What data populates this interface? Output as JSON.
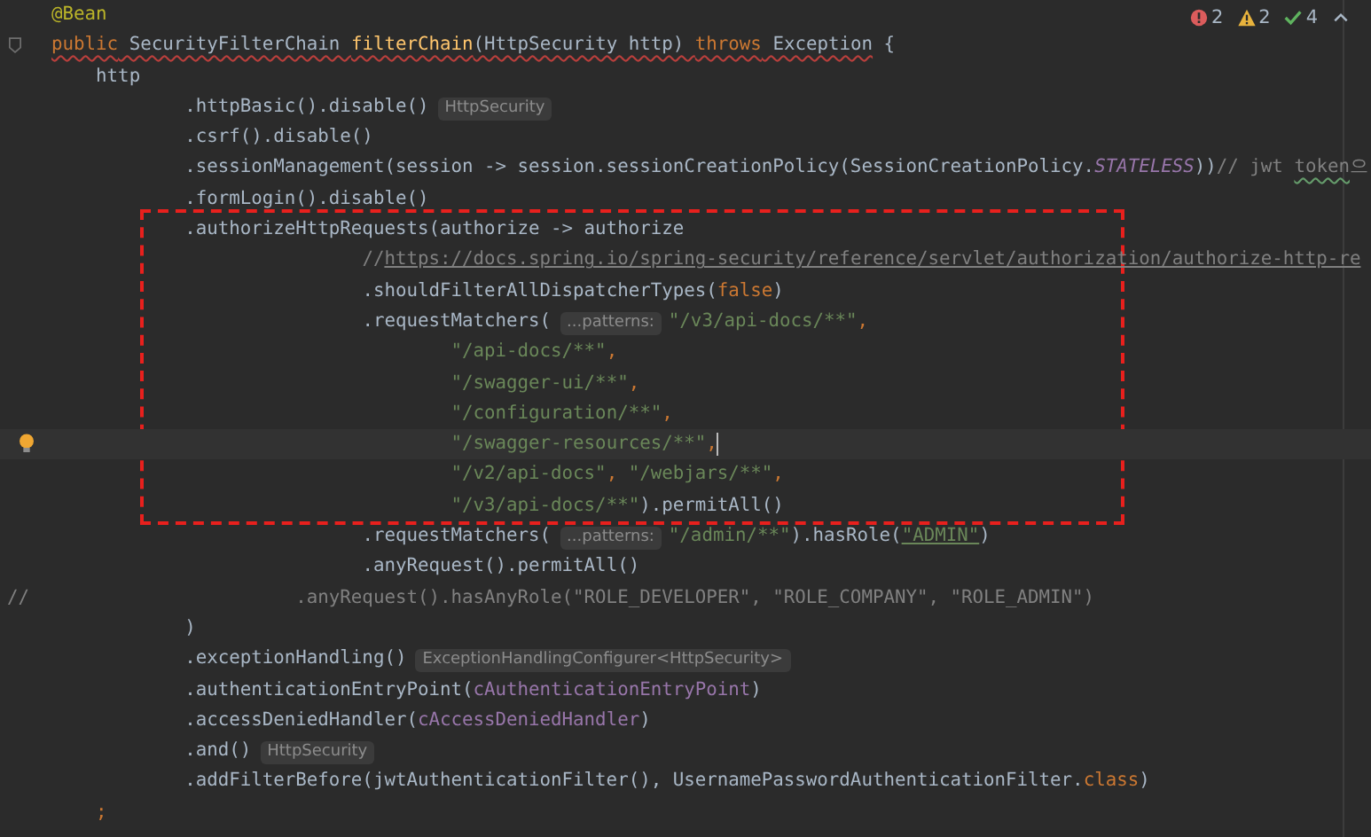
{
  "inspections": [
    {
      "kind": "error",
      "count": "2"
    },
    {
      "kind": "warning",
      "count": "2"
    },
    {
      "kind": "ok",
      "count": "4"
    }
  ],
  "blocks": [
    {
      "framed": false,
      "lines": [
        {
          "current": false,
          "tokens": [
            {
              "kind": "annotation",
              "text": "    @Bean"
            }
          ]
        },
        {
          "current": false,
          "fold_marker": true,
          "tokens": [
            {
              "kind": "keyword",
              "text": "    public",
              "error_underline": true
            },
            {
              "kind": "plain",
              "text": " SecurityFilterChain ",
              "error_underline": true
            },
            {
              "kind": "method",
              "text": "filterChain",
              "error_underline": true
            },
            {
              "kind": "plain",
              "text": "(HttpSecurity http) ",
              "error_underline": true
            },
            {
              "kind": "keyword",
              "text": "throws",
              "error_underline": true
            },
            {
              "kind": "plain",
              "text": " Exception",
              "error_underline": true
            },
            {
              "kind": "plain",
              "text": " {"
            }
          ]
        },
        {
          "current": false,
          "tokens": [
            {
              "kind": "plain",
              "text": "        http"
            }
          ]
        },
        {
          "current": false,
          "tokens": [
            {
              "kind": "plain",
              "text": "                .httpBasic().disable()"
            },
            {
              "kind": "inlay",
              "text": "HttpSecurity"
            }
          ]
        },
        {
          "current": false,
          "tokens": [
            {
              "kind": "plain",
              "text": "                .csrf().disable()"
            }
          ]
        },
        {
          "current": false,
          "tokens": [
            {
              "kind": "plain",
              "text": "                .sessionManagement(session -> session.sessionCreationPolicy(SessionCreationPolicy."
            },
            {
              "kind": "constant",
              "text": "STATELESS"
            },
            {
              "kind": "plain",
              "text": "))"
            },
            {
              "kind": "comment",
              "text": "// jwt "
            },
            {
              "kind": "comment",
              "text": "token",
              "typo_underline": true
            },
            {
              "kind": "comment",
              "text": "으"
            }
          ]
        },
        {
          "current": false,
          "tokens": [
            {
              "kind": "plain",
              "text": "                .formLogin().disable()"
            }
          ]
        }
      ]
    },
    {
      "framed": true,
      "lines": [
        {
          "current": false,
          "tokens": [
            {
              "kind": "plain",
              "text": "                .authorizeHttpRequests(authorize -> authorize"
            }
          ]
        },
        {
          "current": false,
          "tokens": [
            {
              "kind": "comment",
              "text": "                                //"
            },
            {
              "kind": "link",
              "text": "https://docs.spring.io/spring-security/reference/servlet/authorization/authorize-http-re"
            }
          ]
        },
        {
          "current": false,
          "tokens": [
            {
              "kind": "plain",
              "text": "                                .shouldFilterAllDispatcherTypes("
            },
            {
              "kind": "keyword",
              "text": "false"
            },
            {
              "kind": "plain",
              "text": ")"
            }
          ]
        },
        {
          "current": false,
          "tokens": [
            {
              "kind": "plain",
              "text": "                                .requestMatchers("
            },
            {
              "kind": "inlay",
              "text": "...patterns:"
            },
            {
              "kind": "string",
              "text": "\"/v3/api-docs/**\""
            },
            {
              "kind": "keyword",
              "text": ","
            }
          ]
        },
        {
          "current": false,
          "tokens": [
            {
              "kind": "string",
              "text": "                                        \"/api-docs/**\""
            },
            {
              "kind": "keyword",
              "text": ","
            }
          ]
        },
        {
          "current": false,
          "tokens": [
            {
              "kind": "string",
              "text": "                                        \"/swagger-ui/**\""
            },
            {
              "kind": "keyword",
              "text": ","
            }
          ]
        },
        {
          "current": false,
          "tokens": [
            {
              "kind": "string",
              "text": "                                        \"/configuration/**\""
            },
            {
              "kind": "keyword",
              "text": ","
            }
          ]
        },
        {
          "current": true,
          "tokens": [
            {
              "kind": "string",
              "text": "                                        \"/swagger-resources/**\""
            },
            {
              "kind": "keyword",
              "text": ","
            }
          ]
        },
        {
          "current": false,
          "tokens": [
            {
              "kind": "string",
              "text": "                                        \"/v2/api-docs\""
            },
            {
              "kind": "keyword",
              "text": ", "
            },
            {
              "kind": "string",
              "text": "\"/webjars/**\""
            },
            {
              "kind": "keyword",
              "text": ","
            }
          ]
        },
        {
          "current": false,
          "tokens": [
            {
              "kind": "string",
              "text": "                                        \"/v3/api-docs/**\""
            },
            {
              "kind": "plain",
              "text": ").permitAll()"
            }
          ]
        }
      ]
    },
    {
      "framed": false,
      "lines": [
        {
          "current": false,
          "tokens": [
            {
              "kind": "plain",
              "text": "                                .requestMatchers("
            },
            {
              "kind": "inlay",
              "text": "...patterns:"
            },
            {
              "kind": "string",
              "text": "\"/admin/**\""
            },
            {
              "kind": "plain",
              "text": ").hasRole("
            },
            {
              "kind": "string",
              "text": "\"ADMIN\"",
              "underlined": true
            },
            {
              "kind": "plain",
              "text": ")"
            }
          ]
        },
        {
          "current": false,
          "tokens": [
            {
              "kind": "plain",
              "text": "                                .anyRequest().permitAll()"
            }
          ]
        },
        {
          "current": false,
          "tokens": [
            {
              "kind": "comment",
              "text": "//                        .anyRequest().hasAnyRole(\"ROLE_DEVELOPER\", \"ROLE_COMPANY\", \"ROLE_ADMIN\")"
            }
          ]
        },
        {
          "current": false,
          "tokens": [
            {
              "kind": "plain",
              "text": "                )"
            }
          ]
        },
        {
          "current": false,
          "tokens": [
            {
              "kind": "plain",
              "text": "                .exceptionHandling()"
            },
            {
              "kind": "inlay",
              "text": "ExceptionHandlingConfigurer<HttpSecurity>"
            }
          ]
        },
        {
          "current": false,
          "tokens": [
            {
              "kind": "plain",
              "text": "                .authenticationEntryPoint("
            },
            {
              "kind": "field",
              "text": "cAuthenticationEntryPoint"
            },
            {
              "kind": "plain",
              "text": ")"
            }
          ]
        },
        {
          "current": false,
          "tokens": [
            {
              "kind": "plain",
              "text": "                .accessDeniedHandler("
            },
            {
              "kind": "field",
              "text": "cAccessDeniedHandler"
            },
            {
              "kind": "plain",
              "text": ")"
            }
          ]
        },
        {
          "current": false,
          "tokens": [
            {
              "kind": "plain",
              "text": "                .and()"
            },
            {
              "kind": "inlay",
              "text": "HttpSecurity"
            }
          ]
        },
        {
          "current": false,
          "tokens": [
            {
              "kind": "plain",
              "text": "                .addFilterBefore(jwtAuthenticationFilter(), UsernamePasswordAuthenticationFilter."
            },
            {
              "kind": "keyword",
              "text": "class"
            },
            {
              "kind": "plain",
              "text": ")"
            }
          ]
        },
        {
          "current": false,
          "tokens": [
            {
              "kind": "keyword",
              "text": "        ;"
            }
          ]
        }
      ]
    }
  ]
}
